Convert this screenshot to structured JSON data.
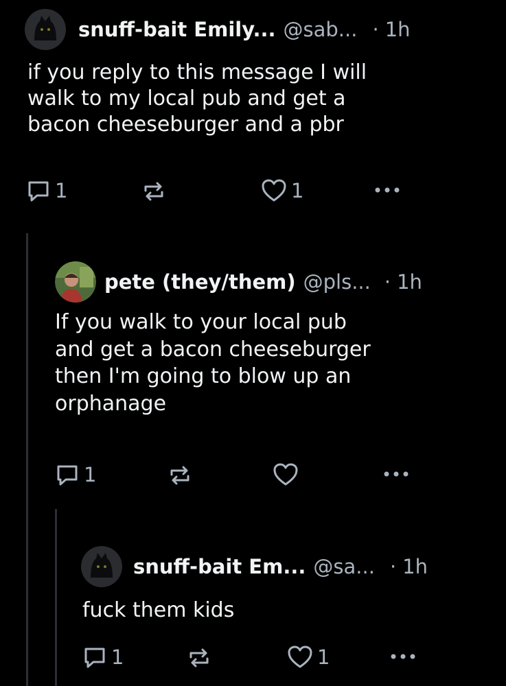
{
  "posts": [
    {
      "author": "snuff-bait Emily...",
      "handle": "@sab...",
      "dot": "·",
      "time": "1h",
      "text": "if you reply to this message I will\nwalk to my local pub and get a\nbacon cheeseburger and a pbr",
      "reply_count": "1",
      "like_count": "1",
      "avatar_icon": "black-cat-avatar"
    },
    {
      "author": "pete (they/them)",
      "handle": "@pls...",
      "dot": "·",
      "time": "1h",
      "text": "If you walk to your local pub\nand get a bacon cheeseburger\nthen I'm going to blow up an\norphanage",
      "reply_count": "1",
      "like_count": "",
      "avatar_icon": "person-avatar"
    },
    {
      "author": "snuff-bait Em...",
      "handle": "@sa...",
      "dot": "·",
      "time": "1h",
      "text": "fuck them kids",
      "reply_count": "1",
      "like_count": "1",
      "avatar_icon": "black-cat-avatar"
    }
  ],
  "colors": {
    "background": "#000000",
    "text": "#f1f3f5",
    "muted": "#aab4bf",
    "thread_line": "#2b2f36"
  }
}
